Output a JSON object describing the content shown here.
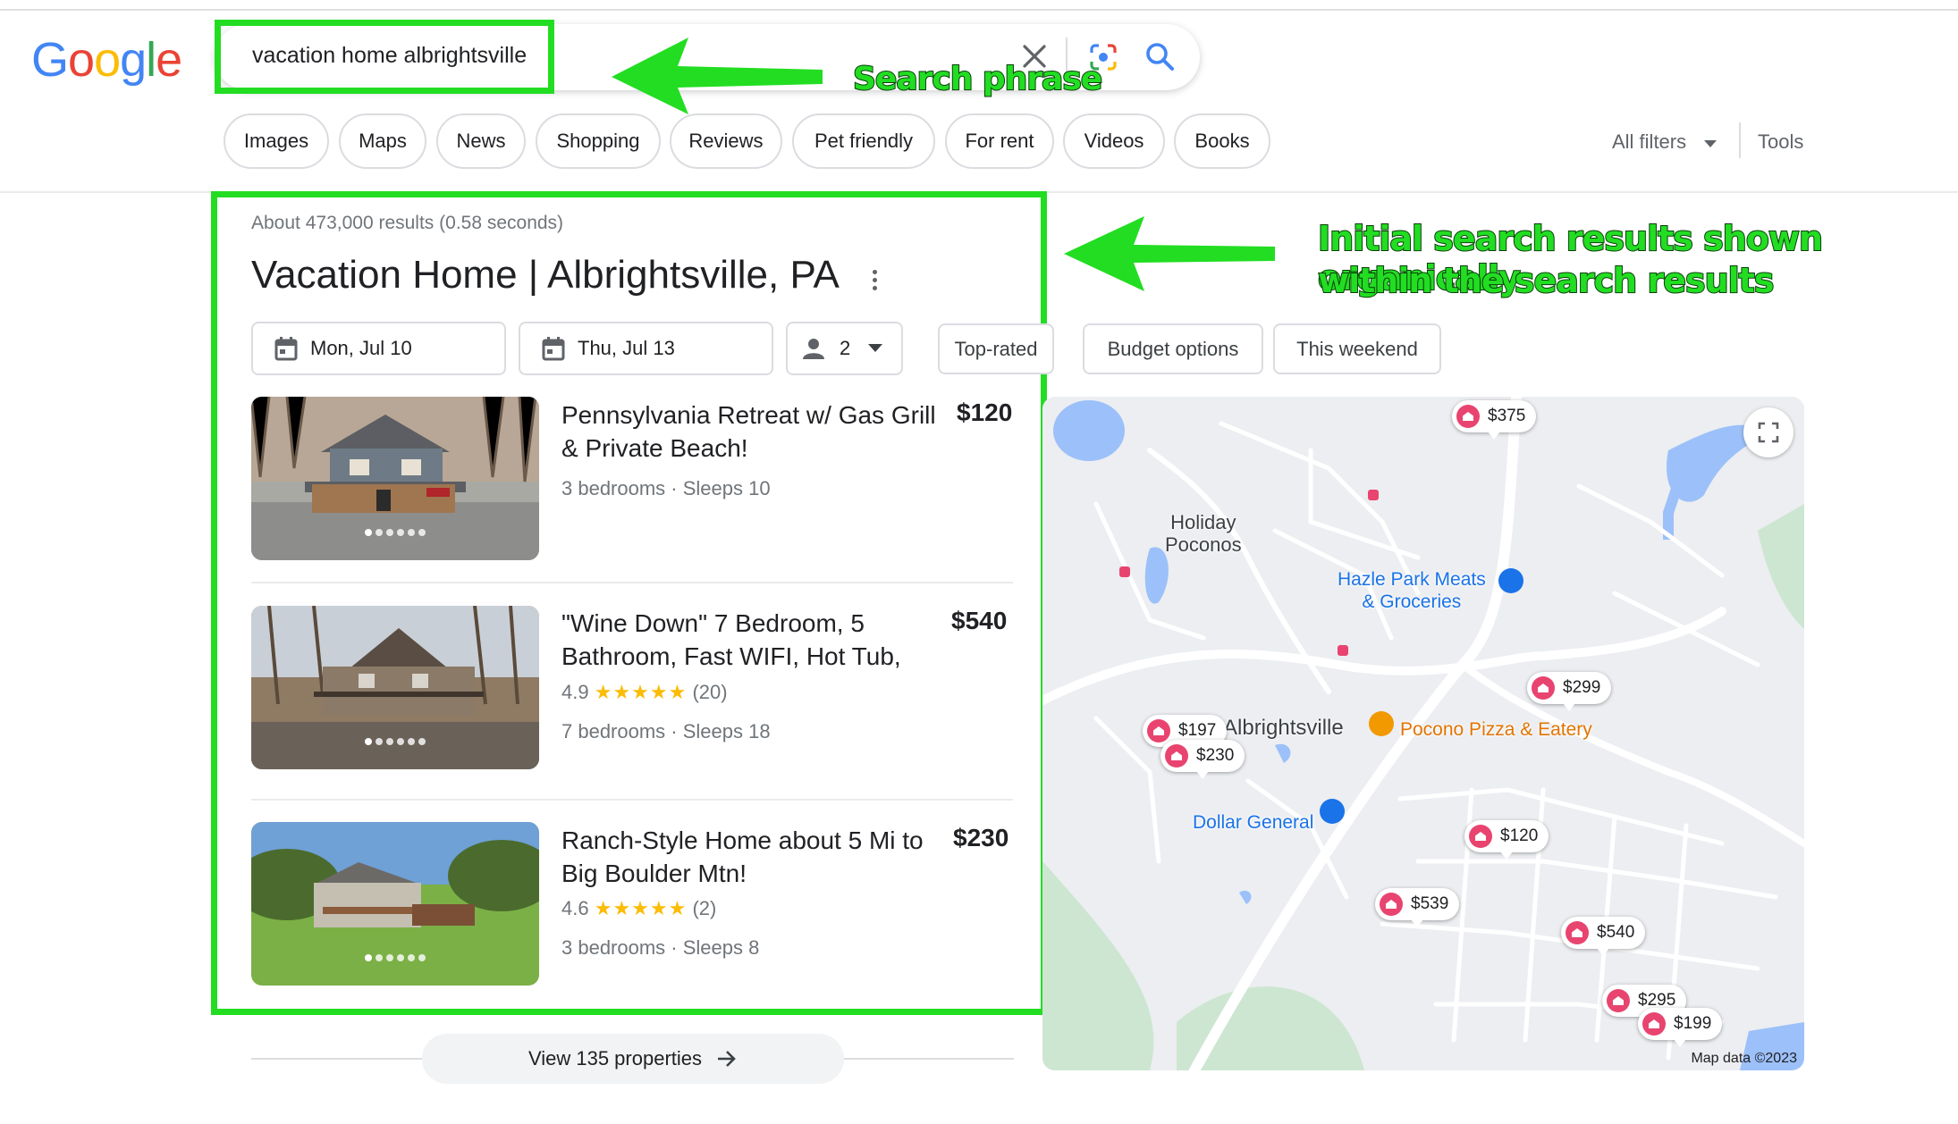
{
  "logo": {
    "letters": [
      "G",
      "o",
      "o",
      "g",
      "l",
      "e"
    ]
  },
  "search": {
    "query": "vacation home albrightsville"
  },
  "annotations": {
    "search_phrase": "Search phrase",
    "results_line1": "Initial search results shown organically",
    "results_line2": "within the search results"
  },
  "filters": [
    "Images",
    "Maps",
    "News",
    "Shopping",
    "Reviews",
    "Pet friendly",
    "For rent",
    "Videos",
    "Books"
  ],
  "all_filters_label": "All filters",
  "tools_label": "Tools",
  "stats": "About 473,000 results (0.58 seconds)",
  "title": "Vacation Home | Albrightsville, PA",
  "controls": {
    "checkin": "Mon, Jul 10",
    "checkout": "Thu, Jul 13",
    "guests": "2",
    "pills": [
      "Top-rated",
      "Budget options",
      "This weekend"
    ]
  },
  "results": [
    {
      "title": "Pennsylvania Retreat w/ Gas Grill & Private Beach!",
      "price": "$120",
      "rating": "",
      "stars": "",
      "reviews": "",
      "meta": "3 bedrooms · Sleeps 10"
    },
    {
      "title": "\"Wine Down\" 7 Bedroom, 5 Bathroom, Fast WIFI, Hot Tub,",
      "price": "$540",
      "rating": "4.9",
      "stars": "★★★★★",
      "reviews": "(20)",
      "meta": "7 bedrooms · Sleeps 18"
    },
    {
      "title": "Ranch-Style Home about 5 Mi to Big Boulder Mtn!",
      "price": "$230",
      "rating": "4.6",
      "stars": "★★★★★",
      "reviews": "(2)",
      "meta": "3 bedrooms · Sleeps 8"
    }
  ],
  "view_all": "View 135 properties",
  "map": {
    "places": {
      "holiday_poconos_1": "Holiday",
      "holiday_poconos_2": "Poconos",
      "hazle_1": "Hazle Park Meats",
      "hazle_2": "& Groceries",
      "albrightsville": "Albrightsville",
      "pizza": "Pocono Pizza & Eatery",
      "dollar": "Dollar General"
    },
    "prices": [
      "$375",
      "$299",
      "$197",
      "$230",
      "$120",
      "$539",
      "$540",
      "$295",
      "$199"
    ],
    "attribution": "Map data ©2023"
  },
  "colors": {
    "highlight": "#22dd22",
    "marker": "#e8446f",
    "link_blue": "#1a73e8",
    "star": "#fbbc04"
  }
}
